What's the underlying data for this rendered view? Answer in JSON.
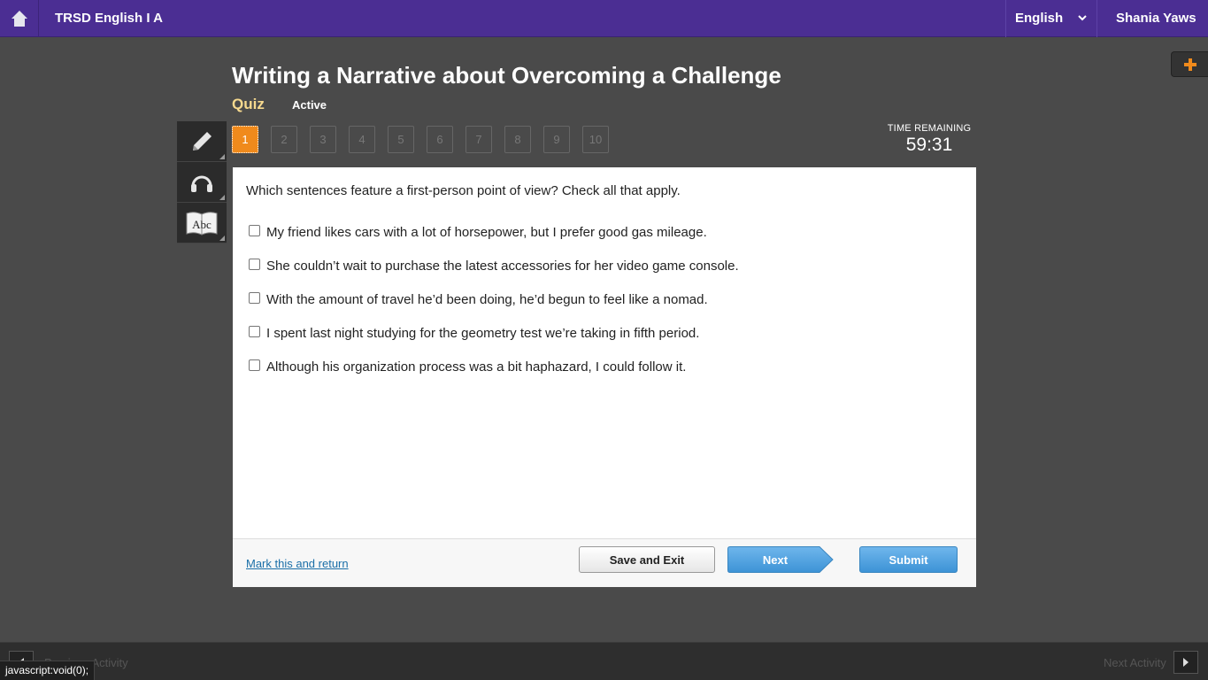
{
  "topbar": {
    "course_title": "TRSD English I A",
    "language": "English",
    "user_name": "Shania Yaws",
    "home_icon": "home-icon",
    "accent_color": "#4b2e93"
  },
  "header": {
    "title": "Writing a Narrative about Overcoming a Challenge",
    "activity_type": "Quiz",
    "status": "Active"
  },
  "tools": [
    {
      "name": "pencil-icon"
    },
    {
      "name": "headphones-icon"
    },
    {
      "name": "dictionary-icon",
      "text": "Abc"
    }
  ],
  "question_nav": {
    "items": [
      "1",
      "2",
      "3",
      "4",
      "5",
      "6",
      "7",
      "8",
      "9",
      "10"
    ],
    "current": "1",
    "active_color": "#f08a1c"
  },
  "timer": {
    "label": "TIME REMAINING",
    "value": "59:31"
  },
  "question": {
    "prompt": "Which sentences feature a first-person point of view? Check all that apply.",
    "options": [
      {
        "text": "My friend likes cars with a lot of horsepower, but I prefer good gas mileage.",
        "checked": false
      },
      {
        "text": "She couldn’t wait to purchase the latest accessories for her video game console.",
        "checked": false
      },
      {
        "text": "With the amount of travel he’d been doing, he’d begun to feel like a nomad.",
        "checked": false
      },
      {
        "text": "I spent last night studying for the geometry test we’re taking in fifth period.",
        "checked": false
      },
      {
        "text": "Although his organization process was a bit haphazard, I could follow it.",
        "checked": false
      }
    ]
  },
  "footer": {
    "mark_label": "Mark this and return",
    "save_label": "Save and Exit",
    "next_label": "Next",
    "submit_label": "Submit"
  },
  "bottombar": {
    "prev_label": "Previous Activity",
    "next_label": "Next Activity"
  },
  "status_bar": {
    "url": "javascript:void(0);"
  }
}
